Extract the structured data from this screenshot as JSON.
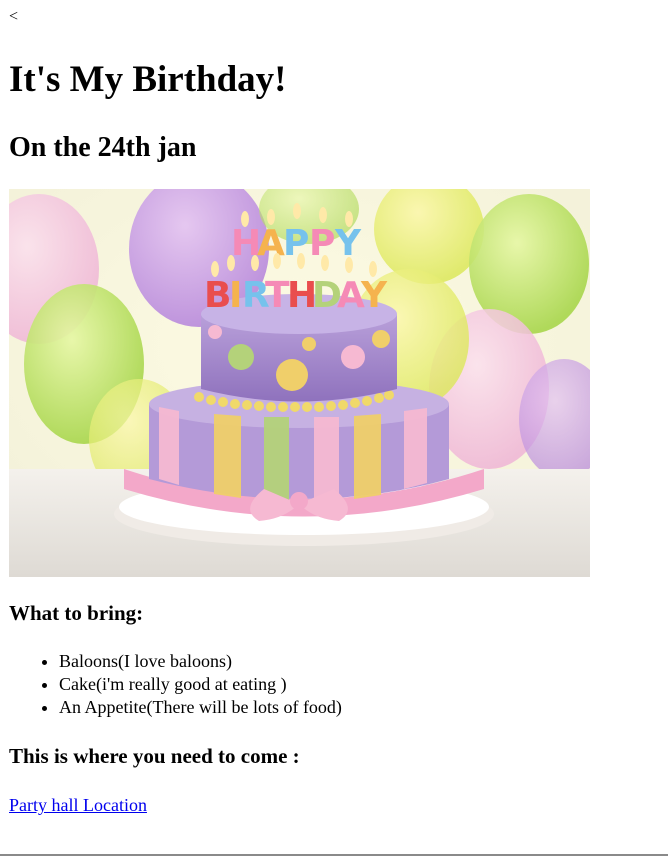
{
  "nav": {
    "back_label": "<"
  },
  "page": {
    "title": "It's My Birthday!",
    "date": "On the 24th jan"
  },
  "image": {
    "icon": "birthday-cake-photo",
    "candle_text_line1": "HAPPY",
    "candle_text_line2": "BIRTHDAY"
  },
  "bring": {
    "heading": "What to bring:",
    "items": [
      "Baloons(I love baloons)",
      "Cake(i'm really good at eating )",
      "An Appetite(There will be lots of food)"
    ]
  },
  "location": {
    "heading": "This is where you need to come :",
    "link_label": "Party hall Location"
  },
  "colors": {
    "link": "#0000ee",
    "cake_top": "#a98fcf",
    "cake_pink": "#f6b9d2",
    "cake_yellow": "#f0cf6a",
    "cake_green": "#b4d27a"
  }
}
